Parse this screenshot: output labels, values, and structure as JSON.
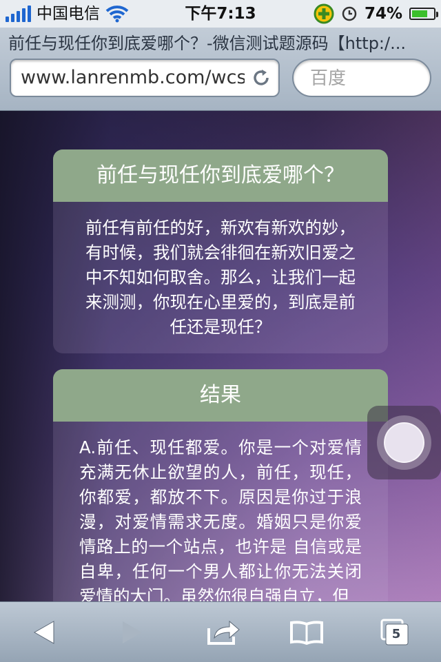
{
  "status_bar": {
    "carrier": "中国电信",
    "time": "下午7:13",
    "battery_percent": "74%",
    "battery_level": 0.74
  },
  "browser": {
    "page_title": "前任与现任你到底爱哪个？-微信测试题源码【http:/...",
    "url": "www.lanrenmb.com/wcs",
    "search_placeholder": "百度"
  },
  "quiz_card": {
    "title": "前任与现任你到底爱哪个？",
    "description": "前任有前任的好，新欢有新欢的妙，有时候，我们就会徘徊在新欢旧爱之中不知如何取舍。那么，让我们一起来测测，你现在心里爱的，到底是前任还是现任？"
  },
  "result_card": {
    "title": "结果",
    "text": "A.前任、现任都爱。你是一个对爱情充满无休止欲望的人，前任，现任，你都爱，都放不下。原因是你过于浪漫，对爱情需求无度。婚姻只是你爱情路上的一个站点，也许是 自信或是自卑，任何一个男人都让你无法关闭爱情的大门。虽然你很自强自立，但"
  },
  "toolbar": {
    "tabs_count": "5"
  },
  "colors": {
    "card_header": "#8fa88a",
    "signal_blue": "#1e66d0",
    "battery_green": "#3bbf2b"
  },
  "icons": [
    "wifi-icon",
    "reload-icon",
    "back-arrow-icon",
    "forward-arrow-icon",
    "share-icon",
    "bookmarks-icon",
    "tabs-icon",
    "alarm-icon",
    "app-badge-icon"
  ]
}
